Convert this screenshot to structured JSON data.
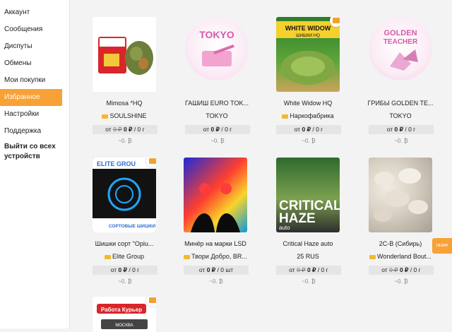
{
  "sidebar": {
    "items": [
      {
        "label": "Аккаунт"
      },
      {
        "label": "Сообщения"
      },
      {
        "label": "Диспуты"
      },
      {
        "label": "Обмены"
      },
      {
        "label": "Мои покупки"
      },
      {
        "label": "Избранное",
        "active": true
      },
      {
        "label": "Настройки"
      },
      {
        "label": "Поддержка"
      },
      {
        "label": "Выйти со всех\nустройств"
      }
    ]
  },
  "products": [
    {
      "title": "Mimosa *HQ",
      "shop": "SOULSHINE",
      "price_prefix": "от",
      "old_price": "0 ₽",
      "price": "0 ₽",
      "unit": "/ 0 г",
      "sub": "~0. ₿"
    },
    {
      "title": "ГАШИШ EURO TOK...",
      "shop": "TOKYO",
      "price_prefix": "от",
      "price": "0 ₽",
      "unit": "/ 0 г",
      "sub": "~0. ₿"
    },
    {
      "title": "White Widow HQ",
      "shop": "Наркофабрика",
      "price_prefix": "от",
      "price": "0 ₽",
      "unit": "/ 0 г",
      "sub": "~0. ₿"
    },
    {
      "title": "ГРИБЫ GOLDEN TE...",
      "shop": "TOKYO",
      "price_prefix": "от",
      "price": "0 ₽",
      "unit": "/ 0 г",
      "sub": "~0. ₿"
    },
    {
      "title": "Шишки сорт \"Opiu...",
      "shop": "Elite Group",
      "price_prefix": "от",
      "price": "0 ₽",
      "unit": "/ 0 г",
      "sub": "~0. ₿"
    },
    {
      "title": "Минёр на марки LSD",
      "shop": "Твори Добро, BR...",
      "price_prefix": "от",
      "price": "0 ₽",
      "unit": "/ 0 шт",
      "sub": "~0. ₿"
    },
    {
      "title": "Critical Haze auto",
      "shop": "25 RUS",
      "price_prefix": "от",
      "old_price": "0 ₽",
      "price": "0 ₽",
      "unit": "/ 0 г",
      "sub": "~0. ₿"
    },
    {
      "title": "2C-B (Сибирь)",
      "shop": "Wonderland Bout...",
      "price_prefix": "от",
      "old_price": "0 ₽",
      "price": "0 ₽",
      "unit": "/ 0 г",
      "sub": "~0. ₿"
    },
    {
      "title": "",
      "shop": "",
      "image_text": "Работа Курьер",
      "image_sub": "МОСКВА"
    }
  ],
  "image_texts": {
    "tokyo": "TOKYO",
    "ww_top": "WHITE WIDOW",
    "ww_sub": "ШИШКИ HQ",
    "golden_1": "GOLDEN",
    "golden_2": "TEACHER",
    "elite_top": "ELITE GROU",
    "elite_bottom": "СОРТОВЫЕ ШИШКИ",
    "haze_1": "CRITICAL",
    "haze_2": "HAZE",
    "haze_3": "auto"
  },
  "side_tab": "газин"
}
